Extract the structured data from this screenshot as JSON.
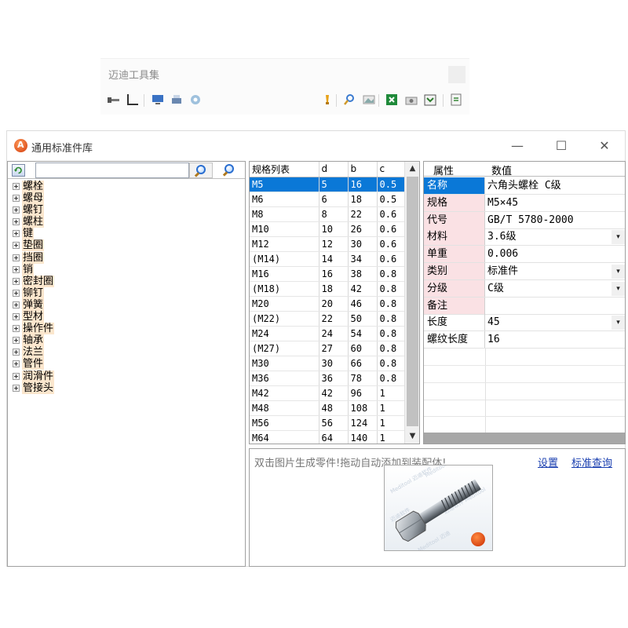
{
  "toolbar": {
    "title": "迈迪工具集",
    "icons": [
      "bolt-tool-icon",
      "angle-tool-icon",
      "monitor-icon",
      "print-tool-icon",
      "gear-icon",
      "marker-icon",
      "search-icon",
      "image-icon",
      "excel-icon",
      "camera-icon",
      "export-icon",
      "document-icon"
    ]
  },
  "window": {
    "title": "通用标准件库",
    "controls": {
      "minimize": "—",
      "maximize": "☐",
      "close": "✕"
    }
  },
  "left_panel": {
    "search_value": "",
    "tree_items": [
      "螺栓",
      "螺母",
      "螺钉",
      "螺柱",
      "键",
      "垫圈",
      "挡圈",
      "销",
      "密封圈",
      "铆钉",
      "弹簧",
      "型材",
      "操作件",
      "轴承",
      "法兰",
      "管件",
      "润滑件",
      "管接头"
    ]
  },
  "spec_table": {
    "columns": [
      "规格列表",
      "d",
      "b",
      "c"
    ],
    "rows": [
      [
        "M5",
        "5",
        "16",
        "0.5"
      ],
      [
        "M6",
        "6",
        "18",
        "0.5"
      ],
      [
        "M8",
        "8",
        "22",
        "0.6"
      ],
      [
        "M10",
        "10",
        "26",
        "0.6"
      ],
      [
        "M12",
        "12",
        "30",
        "0.6"
      ],
      [
        "(M14)",
        "14",
        "34",
        "0.6"
      ],
      [
        "M16",
        "16",
        "38",
        "0.8"
      ],
      [
        "(M18)",
        "18",
        "42",
        "0.8"
      ],
      [
        "M20",
        "20",
        "46",
        "0.8"
      ],
      [
        "(M22)",
        "22",
        "50",
        "0.8"
      ],
      [
        "M24",
        "24",
        "54",
        "0.8"
      ],
      [
        "(M27)",
        "27",
        "60",
        "0.8"
      ],
      [
        "M30",
        "30",
        "66",
        "0.8"
      ],
      [
        "M36",
        "36",
        "78",
        "0.8"
      ],
      [
        "M42",
        "42",
        "96",
        "1"
      ],
      [
        "M48",
        "48",
        "108",
        "1"
      ],
      [
        "M56",
        "56",
        "124",
        "1"
      ],
      [
        "M64",
        "64",
        "140",
        "1"
      ]
    ],
    "selected_row": 0
  },
  "properties": {
    "header_key": "属性",
    "header_value": "数值",
    "rows": [
      {
        "key": "名称",
        "value": "六角头螺栓 C级",
        "style": "blue",
        "dropdown": false
      },
      {
        "key": "规格",
        "value": "M5×45",
        "style": "pink",
        "dropdown": false
      },
      {
        "key": "代号",
        "value": "GB/T 5780-2000",
        "style": "pink",
        "dropdown": false
      },
      {
        "key": "材料",
        "value": "3.6级",
        "style": "pink",
        "dropdown": true
      },
      {
        "key": "单重",
        "value": "0.006",
        "style": "pink",
        "dropdown": false
      },
      {
        "key": "类别",
        "value": "标准件",
        "style": "pink",
        "dropdown": true
      },
      {
        "key": "分级",
        "value": "C级",
        "style": "pink",
        "dropdown": true
      },
      {
        "key": "备注",
        "value": "",
        "style": "pink",
        "dropdown": false
      },
      {
        "key": "长度",
        "value": "45",
        "style": "none",
        "dropdown": true
      },
      {
        "key": "螺纹长度",
        "value": "16",
        "style": "none",
        "dropdown": false
      }
    ]
  },
  "preview": {
    "hint": "双击图片生成零件!拖动自动添加到装配体!",
    "settings_link": "设置",
    "standard_link": "标准查询"
  }
}
